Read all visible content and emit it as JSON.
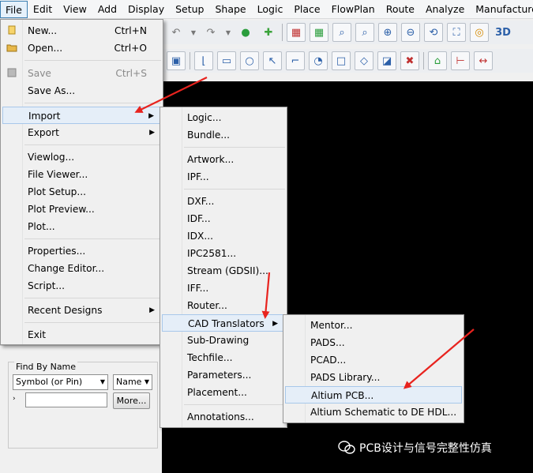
{
  "menubar": [
    {
      "label": "File",
      "active": true
    },
    {
      "label": "Edit"
    },
    {
      "label": "View"
    },
    {
      "label": "Add"
    },
    {
      "label": "Display"
    },
    {
      "label": "Setup"
    },
    {
      "label": "Shape"
    },
    {
      "label": "Logic"
    },
    {
      "label": "Place"
    },
    {
      "label": "FlowPlan"
    },
    {
      "label": "Route"
    },
    {
      "label": "Analyze"
    },
    {
      "label": "Manufacture"
    }
  ],
  "toolbar3d": "3D",
  "file_menu": {
    "items": [
      {
        "label": "New...",
        "shortcut": "Ctrl+N"
      },
      {
        "label": "Open...",
        "shortcut": "Ctrl+O"
      },
      {
        "label": "Save",
        "shortcut": "Ctrl+S"
      },
      {
        "label": "Save As..."
      },
      {
        "label": "Import",
        "submenu": true
      },
      {
        "label": "Export",
        "submenu": true
      },
      {
        "label": "Viewlog..."
      },
      {
        "label": "File Viewer..."
      },
      {
        "label": "Plot Setup..."
      },
      {
        "label": "Plot Preview..."
      },
      {
        "label": "Plot..."
      },
      {
        "label": "Properties..."
      },
      {
        "label": "Change Editor..."
      },
      {
        "label": "Script..."
      },
      {
        "label": "Recent Designs",
        "submenu": true
      },
      {
        "label": "Exit"
      }
    ]
  },
  "import_menu": {
    "items": [
      {
        "label": "Logic..."
      },
      {
        "label": "Bundle..."
      },
      {
        "label": "Artwork..."
      },
      {
        "label": "IPF..."
      },
      {
        "label": "DXF..."
      },
      {
        "label": "IDF..."
      },
      {
        "label": "IDX..."
      },
      {
        "label": "IPC2581..."
      },
      {
        "label": "Stream (GDSII)..."
      },
      {
        "label": "IFF..."
      },
      {
        "label": "Router..."
      },
      {
        "label": "CAD Translators",
        "submenu": true
      },
      {
        "label": "Sub-Drawing"
      },
      {
        "label": "Techfile..."
      },
      {
        "label": "Parameters..."
      },
      {
        "label": "Placement..."
      },
      {
        "label": "Annotations..."
      }
    ]
  },
  "cad_menu": {
    "items": [
      {
        "label": "Mentor..."
      },
      {
        "label": "PADS..."
      },
      {
        "label": "PCAD..."
      },
      {
        "label": "PADS Library..."
      },
      {
        "label": "Altium PCB..."
      },
      {
        "label": "Altium Schematic to DE HDL..."
      }
    ]
  },
  "find_by_name": {
    "title": "Find By Name",
    "type_value": "Symbol (or Pin)",
    "mode_value": "Name",
    "more_label": "More..."
  },
  "watermark": "PCB设计与信号完整性仿真",
  "colors": {
    "arrow": "#e8231e",
    "highlight": "#e5eef8",
    "canvas": "#000000"
  }
}
